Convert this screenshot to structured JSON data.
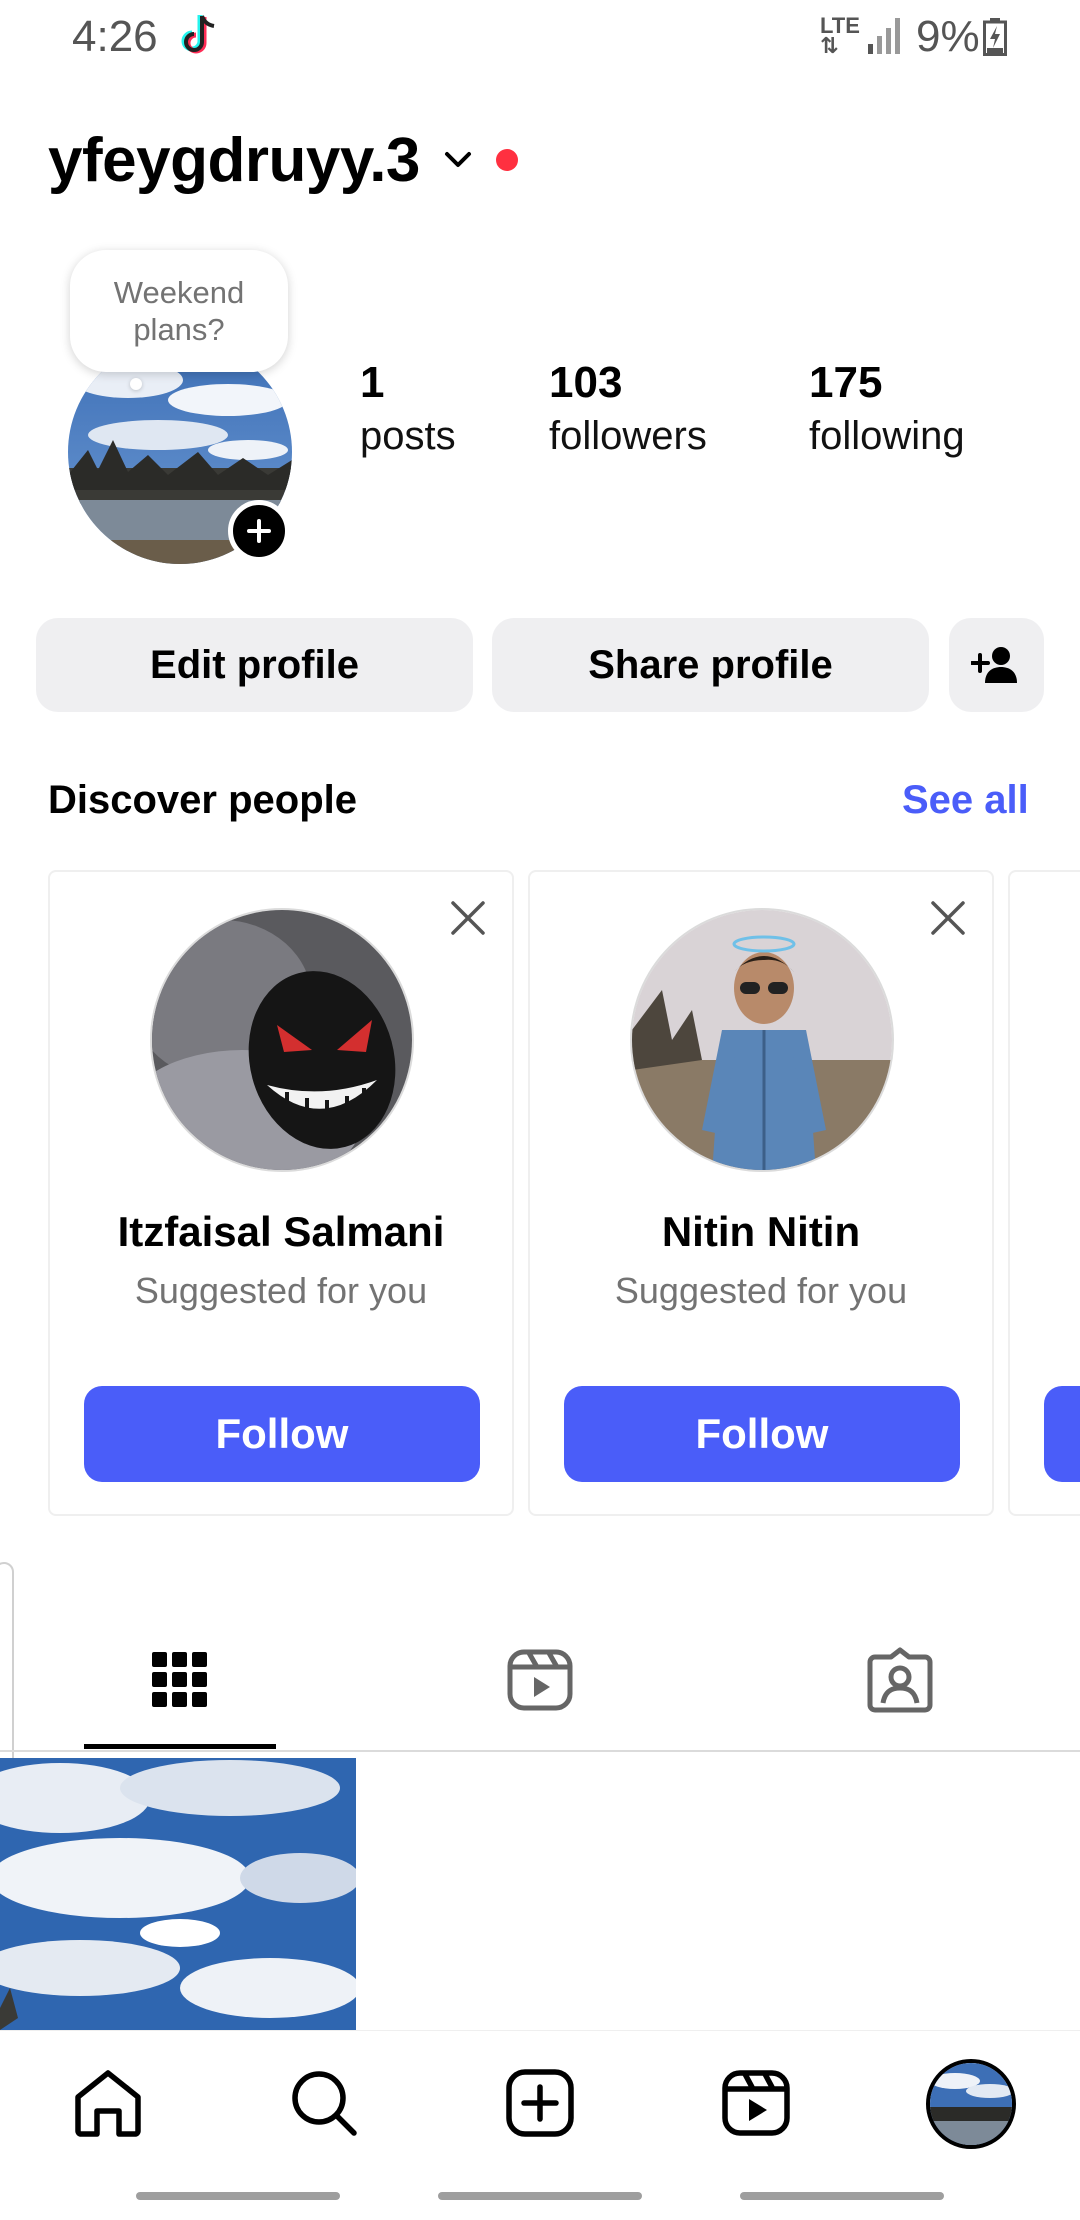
{
  "status_bar": {
    "time": "4:26",
    "network": "LTE",
    "battery": "9%",
    "icons": [
      "tiktok-icon",
      "signal-icon",
      "battery-charging-icon"
    ]
  },
  "header": {
    "username": "yfeygdruyy.3",
    "indicator_color": "#ff3040"
  },
  "profile": {
    "note": "Weekend plans?",
    "stats": {
      "posts": {
        "value": "1",
        "label": "posts"
      },
      "followers": {
        "value": "103",
        "label": "followers"
      },
      "following": {
        "value": "175",
        "label": "following"
      }
    }
  },
  "actions": {
    "edit_profile": "Edit profile",
    "share_profile": "Share profile"
  },
  "discover": {
    "title": "Discover people",
    "see_all": "See all",
    "suggestions": [
      {
        "name": "Itzfaisal Salmani",
        "subtitle": "Suggested for you",
        "button": "Follow"
      },
      {
        "name": "Nitin Nitin",
        "subtitle": "Suggested for you",
        "button": "Follow"
      }
    ]
  },
  "tabs": [
    "grid-icon",
    "reels-icon",
    "tagged-icon"
  ],
  "bottom_nav": [
    "home-icon",
    "search-icon",
    "create-icon",
    "reels-icon",
    "profile-avatar"
  ],
  "colors": {
    "accent": "#4a5df9",
    "button_bg": "#efeff1",
    "muted_text": "#737373"
  }
}
